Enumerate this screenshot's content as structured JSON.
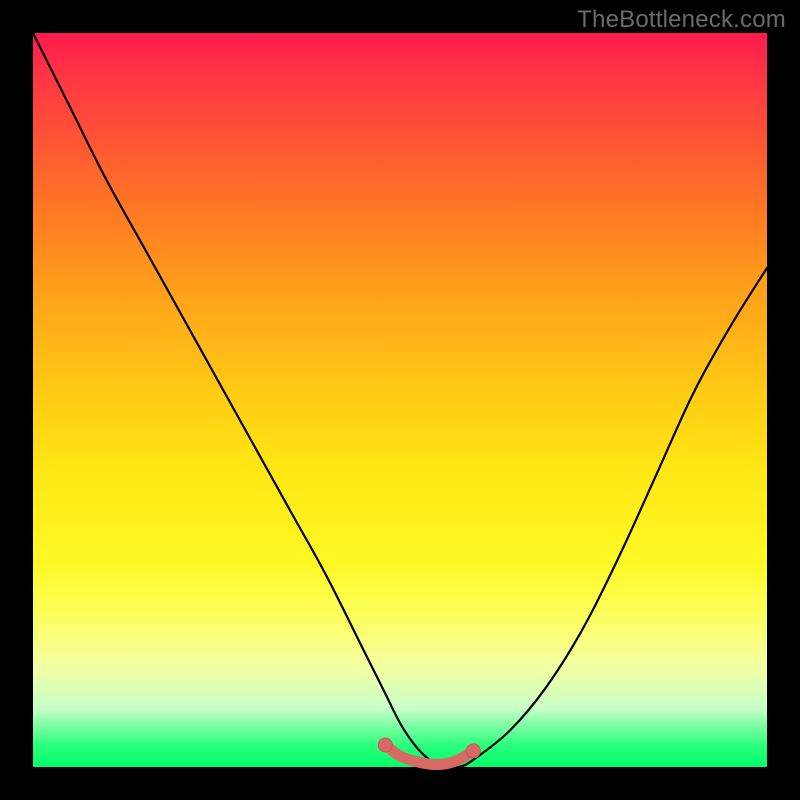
{
  "watermark": {
    "text": "TheBottleneck.com"
  },
  "colors": {
    "curve_stroke": "#000000",
    "marker_fill": "#d86a66",
    "marker_stroke": "#c85852"
  },
  "chart_data": {
    "type": "line",
    "title": "",
    "xlabel": "",
    "ylabel": "",
    "ylim": [
      0,
      100
    ],
    "xlim": [
      0,
      100
    ],
    "series": [
      {
        "name": "bottleneck-curve",
        "x": [
          0,
          5,
          10,
          15,
          20,
          25,
          30,
          35,
          40,
          45,
          48,
          50,
          52,
          54,
          56,
          58,
          60,
          65,
          70,
          75,
          80,
          85,
          90,
          95,
          100
        ],
        "values": [
          100,
          90,
          80,
          71,
          62,
          53,
          44,
          35,
          26,
          16,
          10,
          6,
          3,
          1,
          0,
          0,
          1,
          5,
          11,
          19,
          29,
          40,
          51,
          60,
          68
        ]
      }
    ],
    "markers": {
      "name": "bottom-segment",
      "x": [
        48,
        50,
        52,
        54,
        56,
        58,
        60
      ],
      "values": [
        3,
        1.5,
        0.8,
        0.4,
        0.4,
        1.0,
        2.2
      ]
    }
  }
}
